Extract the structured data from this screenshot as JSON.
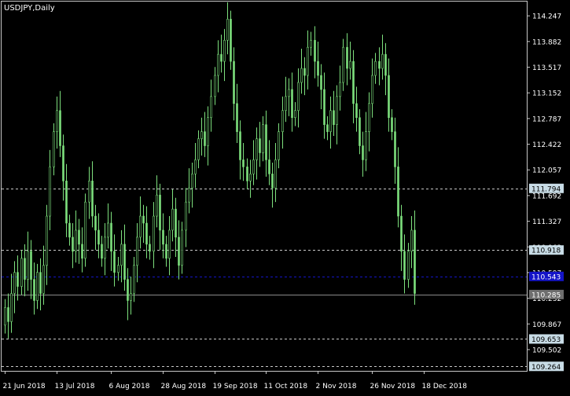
{
  "symbol_label": "USDJPY,Daily",
  "colors": {
    "background": "#000000",
    "frame": "#c8c8c8",
    "candle": "#7de07d",
    "axis_text": "#ffffff",
    "dashed_line": "#c8c8c8",
    "blue_line": "#1414c8",
    "level_tag_bg": "#c8dce6",
    "level_tag_text": "#000000",
    "blue_tag_bg": "#1414c8",
    "grey_tag_bg": "#6e6e6e"
  },
  "chart_data": {
    "type": "candlestick",
    "title": "USDJPY,Daily",
    "ylim": [
      109.2,
      114.45
    ],
    "y_ticks": [
      "114.247",
      "113.882",
      "113.517",
      "113.152",
      "112.787",
      "112.422",
      "112.057",
      "111.692",
      "111.327",
      "110.962",
      "110.597",
      "110.232",
      "109.867",
      "109.502"
    ],
    "x_ticks": [
      "21 Jun 2018",
      "13 Jul 2018",
      "6 Aug 2018",
      "28 Aug 2018",
      "19 Sep 2018",
      "11 Oct 2018",
      "2 Nov 2018",
      "26 Nov 2018",
      "18 Dec 2018"
    ],
    "x_tick_index": [
      0,
      16,
      33,
      49,
      65,
      81,
      97,
      114,
      130
    ],
    "levels": [
      {
        "value": 111.794,
        "label": "111.794",
        "style": "dashed"
      },
      {
        "value": 110.918,
        "label": "110.918",
        "style": "dashed"
      },
      {
        "value": 110.543,
        "label": "110.543",
        "style": "blue"
      },
      {
        "value": 110.285,
        "label": "110.285",
        "style": "grey"
      },
      {
        "value": 109.653,
        "label": "109.653",
        "style": "dashed"
      },
      {
        "value": 109.264,
        "label": "109.264",
        "style": "dashed"
      }
    ],
    "close": [
      110.1,
      109.9,
      110.3,
      110.6,
      110.4,
      110.8,
      110.5,
      110.9,
      110.5,
      110.2,
      110.6,
      110.3,
      110.7,
      111.4,
      112.1,
      112.6,
      112.9,
      112.4,
      111.9,
      111.3,
      111.1,
      110.9,
      111.2,
      111.0,
      110.8,
      111.6,
      111.9,
      111.4,
      111.2,
      111.0,
      110.8,
      111.1,
      111.3,
      110.9,
      110.6,
      110.7,
      111.0,
      110.5,
      110.2,
      110.3,
      110.7,
      111.1,
      111.4,
      111.3,
      111.0,
      110.9,
      111.4,
      111.7,
      111.2,
      111.0,
      110.8,
      111.2,
      111.5,
      111.1,
      110.7,
      111.2,
      111.6,
      111.8,
      112.0,
      112.2,
      112.5,
      112.6,
      112.4,
      112.8,
      113.1,
      113.4,
      113.7,
      113.6,
      113.9,
      114.2,
      113.6,
      113.0,
      112.6,
      112.2,
      112.1,
      111.9,
      112.0,
      112.2,
      112.5,
      112.3,
      112.7,
      112.2,
      112.0,
      111.8,
      112.2,
      112.6,
      112.9,
      113.1,
      113.2,
      112.8,
      112.9,
      113.3,
      113.5,
      113.4,
      113.8,
      113.9,
      113.6,
      113.4,
      113.2,
      112.7,
      112.6,
      112.9,
      112.7,
      113.1,
      113.3,
      113.8,
      113.5,
      113.6,
      113.0,
      112.8,
      112.4,
      112.2,
      112.6,
      113.0,
      113.4,
      113.6,
      113.5,
      113.7,
      113.4,
      112.8,
      112.6,
      112.1,
      111.4,
      110.9,
      110.5,
      110.9,
      111.2,
      110.3
    ]
  }
}
